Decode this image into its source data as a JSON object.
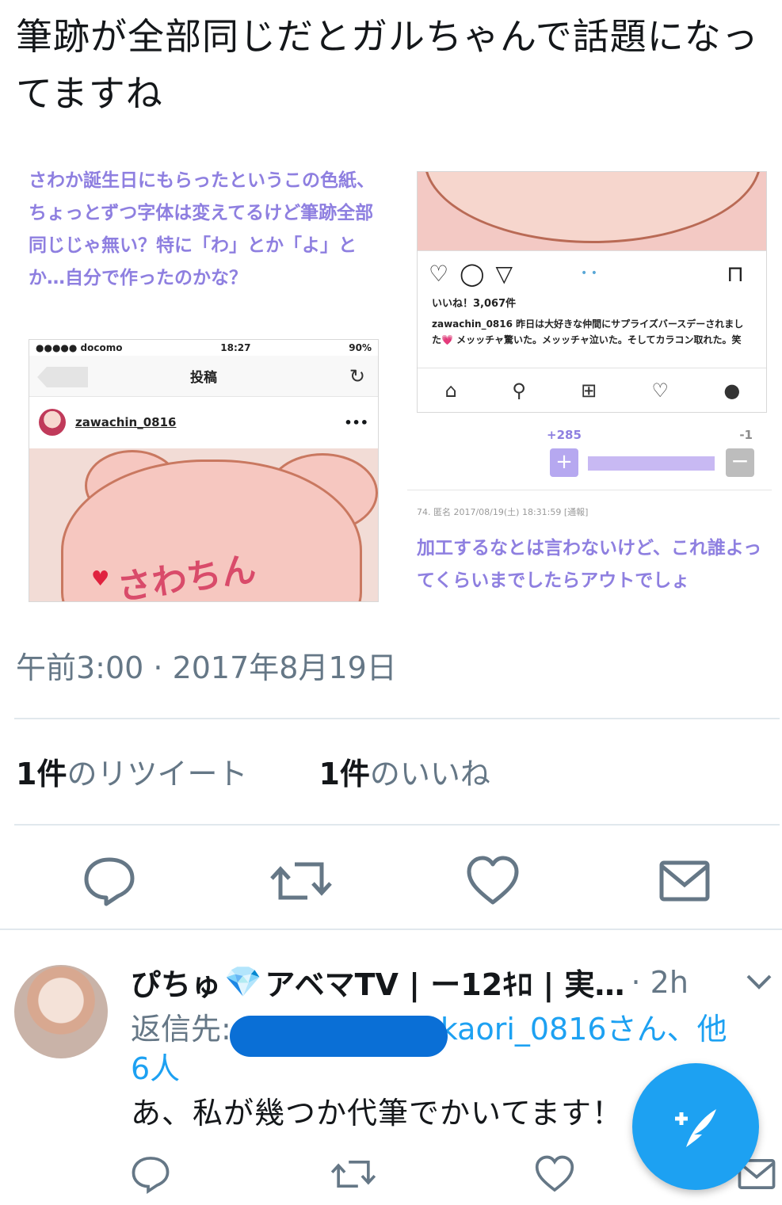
{
  "tweet": {
    "text": "筆跡が全部同じだとガルちゃんで話題になってますね",
    "timestamp": "午前3:00 · 2017年8月19日",
    "retweet_count": "1件",
    "retweet_label": "のリツイート",
    "like_count": "1件",
    "like_label": "のいいね"
  },
  "embedded": {
    "left_comment": "さわか誕生日にもらったというこの色紙、ちょっとずつ字体は変えてるけど筆跡全部同じじゃ無い？特に「わ」とか「よ」とか…自分で作ったのかな？",
    "status_carrier": "●●●●● docomo",
    "status_time": "18:27",
    "status_battery": "90%",
    "nav_title": "投稿",
    "post_username": "zawachin_0816",
    "photo_sign": "さわちん",
    "insta_likes": "いいね！3,067件",
    "insta_caption_user": "zawachin_0816",
    "insta_caption_text": "昨日は大好きな仲間にサプライズバースデーされました💗 メッッチャ驚いた。メッッチャ泣いた。そしてカラコン取れた。笑",
    "vote_plus": "+285",
    "vote_minus": "-1",
    "comment_meta": "74. 匿名 2017/08/19(土) 18:31:59 [通報]",
    "right_comment": "加工するなとは言わないけど、これ誰よってくらいまでしたらアウトでしょ"
  },
  "reply": {
    "name": "ぴちゅ",
    "name_suffix": "アベマTV | ー12ｷﾛ | 実…",
    "time": "· 2h",
    "reply_prefix": "返信先:",
    "reply_mid": "ん、",
    "reply_handle": "@kaori_0816さん",
    "reply_others": "、他6人",
    "text": "あ、私が幾つか代筆でかいてます！"
  },
  "colors": {
    "twitter_blue": "#1da1f2",
    "gray_text": "#657786",
    "purple": "#8e7fe0"
  },
  "icons": [
    "reply-icon",
    "retweet-icon",
    "like-icon",
    "share-icon",
    "chevron-down-icon",
    "compose-tweet-icon"
  ]
}
